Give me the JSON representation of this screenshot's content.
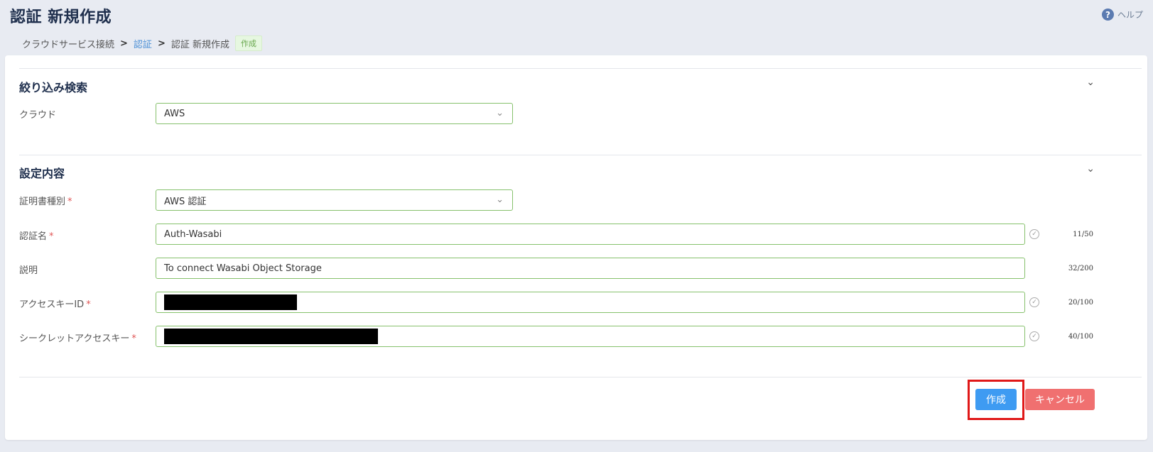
{
  "header": {
    "title": "認証 新規作成",
    "help_label": "ヘルプ",
    "help_icon": "?"
  },
  "breadcrumb": {
    "items": [
      "クラウドサービス接続",
      "認証",
      "認証 新規作成"
    ],
    "separator": ">",
    "badge": "作成"
  },
  "filter_section": {
    "title": "絞り込み検索",
    "cloud_label": "クラウド",
    "cloud_value": "AWS"
  },
  "settings_section": {
    "title": "設定内容",
    "cert_type_label": "証明書種別",
    "cert_type_value": "AWS 認証",
    "auth_name_label": "認証名",
    "auth_name_value": "Auth-Wasabi",
    "auth_name_counter": "11/50",
    "description_label": "説明",
    "description_value": "To connect Wasabi Object Storage",
    "description_counter": "32/200",
    "access_key_label": "アクセスキーID",
    "access_key_counter": "20/100",
    "secret_key_label": "シークレットアクセスキー",
    "secret_key_counter": "40/100",
    "required_mark": "*"
  },
  "actions": {
    "create_label": "作成",
    "cancel_label": "キャンセル"
  },
  "icons": {
    "chevron": "⌄",
    "check": "✓"
  },
  "colors": {
    "primary": "#3e9bf2",
    "danger": "#f07070",
    "field_border": "#86c16c",
    "highlight": "#e01818"
  }
}
